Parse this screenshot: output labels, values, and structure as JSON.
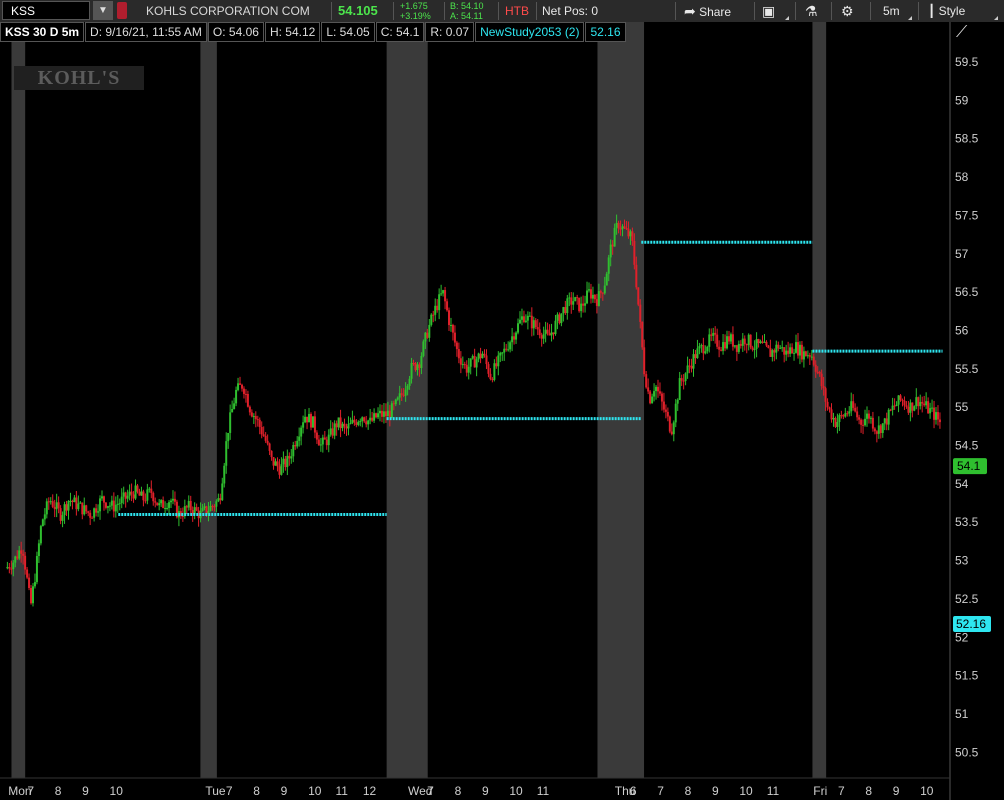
{
  "toolbar": {
    "symbol": "KSS",
    "company": "KOHLS CORPORATION COM",
    "last": "54.105",
    "change_abs": "+1.675",
    "change_pct": "+3.19%",
    "bid": "B: 54.10",
    "ask": "A: 54.11",
    "htb": "HTB",
    "net_pos": "Net Pos: 0",
    "share_label": "Share",
    "aggregation": "5m",
    "style_label": "Style"
  },
  "header": {
    "symbol_period": "KSS 30 D 5m",
    "date": "D: 9/16/21, 11:55 AM",
    "open": "O: 54.06",
    "high": "H: 54.12",
    "low": "L: 54.05",
    "close": "C: 54.1",
    "range": "R: 0.07",
    "study": "NewStudy2053 (2)",
    "study_value": "52.16"
  },
  "logo_text": "KOHĽS",
  "colors": {
    "up": "#2fbf2f",
    "down": "#e0202a",
    "study": "#2ee6f0",
    "shade": "#3a3a3a",
    "price_label": "#2fbf2f"
  },
  "chart_data": {
    "type": "candlestick",
    "y_axis": {
      "min": 50.25,
      "max": 59.75,
      "ticks": [
        "59.5",
        "59",
        "58.5",
        "58",
        "57.5",
        "57",
        "56.5",
        "56",
        "55.5",
        "55",
        "54.5",
        "54",
        "53.5",
        "53",
        "52.5",
        "52",
        "51.5",
        "51",
        "50.5"
      ]
    },
    "x_axis_labels": [
      {
        "label": "Mon",
        "t": 0.3
      },
      {
        "label": "7",
        "t": 1.0
      },
      {
        "label": "8",
        "t": 2.0
      },
      {
        "label": "9",
        "t": 3.0
      },
      {
        "label": "10",
        "t": 4.0
      },
      {
        "label": "Tue",
        "t": 7.5
      },
      {
        "label": "7",
        "t": 8.25
      },
      {
        "label": "8",
        "t": 9.25
      },
      {
        "label": "9",
        "t": 10.25
      },
      {
        "label": "10",
        "t": 11.25
      },
      {
        "label": "11",
        "t": 12.25
      },
      {
        "label": "12",
        "t": 13.25
      },
      {
        "label": "Wed",
        "t": 14.9
      },
      {
        "label": "7",
        "t": 15.6
      },
      {
        "label": "8",
        "t": 16.6
      },
      {
        "label": "9",
        "t": 17.6
      },
      {
        "label": "10",
        "t": 18.6
      },
      {
        "label": "11",
        "t": 19.6
      },
      {
        "label": "Thu",
        "t": 22.45
      },
      {
        "label": "6",
        "t": 23.0
      },
      {
        "label": "7",
        "t": 24.0
      },
      {
        "label": "8",
        "t": 25.0
      },
      {
        "label": "9",
        "t": 26.0
      },
      {
        "label": "10",
        "t": 27.0
      },
      {
        "label": "11",
        "t": 28.0
      },
      {
        "label": "Fri",
        "t": 29.7
      },
      {
        "label": "7",
        "t": 30.6
      },
      {
        "label": "8",
        "t": 31.6
      },
      {
        "label": "9",
        "t": 32.6
      },
      {
        "label": "10",
        "t": 33.6
      }
    ],
    "shaded_sessions": [
      [
        0.2,
        0.7
      ],
      [
        7.1,
        7.7
      ],
      [
        13.9,
        15.4
      ],
      [
        21.6,
        23.3
      ],
      [
        29.45,
        29.95
      ]
    ],
    "study_levels": [
      {
        "from": 4.1,
        "to": 13.9,
        "value": 53.6
      },
      {
        "from": 13.9,
        "to": 23.2,
        "value": 54.85
      },
      {
        "from": 23.2,
        "to": 29.45,
        "value": 57.15
      },
      {
        "from": 29.45,
        "to": 34.2,
        "value": 55.73
      }
    ],
    "price_path": [
      [
        0.0,
        52.9
      ],
      [
        0.3,
        53.0
      ],
      [
        0.6,
        53.2
      ],
      [
        0.9,
        52.4
      ],
      [
        1.1,
        52.9
      ],
      [
        1.3,
        53.5
      ],
      [
        1.6,
        53.8
      ],
      [
        2.0,
        53.6
      ],
      [
        2.3,
        53.8
      ],
      [
        2.7,
        53.7
      ],
      [
        3.1,
        53.6
      ],
      [
        3.5,
        53.8
      ],
      [
        3.9,
        53.7
      ],
      [
        4.3,
        53.8
      ],
      [
        4.7,
        53.9
      ],
      [
        5.0,
        53.8
      ],
      [
        5.3,
        53.9
      ],
      [
        5.6,
        53.7
      ],
      [
        6.0,
        53.8
      ],
      [
        6.3,
        53.6
      ],
      [
        6.7,
        53.7
      ],
      [
        7.1,
        53.6
      ],
      [
        7.5,
        53.7
      ],
      [
        7.8,
        53.8
      ],
      [
        8.1,
        54.7
      ],
      [
        8.4,
        55.2
      ],
      [
        8.65,
        55.3
      ],
      [
        8.9,
        55.0
      ],
      [
        9.2,
        54.8
      ],
      [
        9.45,
        54.6
      ],
      [
        9.7,
        54.3
      ],
      [
        10.0,
        54.2
      ],
      [
        10.3,
        54.3
      ],
      [
        10.6,
        54.6
      ],
      [
        10.9,
        54.9
      ],
      [
        11.2,
        54.8
      ],
      [
        11.5,
        54.5
      ],
      [
        11.8,
        54.6
      ],
      [
        12.1,
        54.8
      ],
      [
        12.4,
        54.7
      ],
      [
        12.7,
        54.8
      ],
      [
        13.0,
        54.9
      ],
      [
        13.3,
        54.8
      ],
      [
        13.6,
        54.9
      ],
      [
        13.9,
        54.9
      ],
      [
        14.2,
        55.0
      ],
      [
        14.5,
        55.2
      ],
      [
        14.8,
        55.5
      ],
      [
        15.1,
        55.6
      ],
      [
        15.4,
        56.0
      ],
      [
        15.7,
        56.3
      ],
      [
        15.95,
        56.5
      ],
      [
        16.2,
        56.1
      ],
      [
        16.5,
        55.7
      ],
      [
        16.8,
        55.5
      ],
      [
        17.1,
        55.6
      ],
      [
        17.4,
        55.7
      ],
      [
        17.7,
        55.4
      ],
      [
        18.0,
        55.6
      ],
      [
        18.3,
        55.8
      ],
      [
        18.6,
        56.0
      ],
      [
        18.9,
        56.2
      ],
      [
        19.2,
        56.1
      ],
      [
        19.5,
        56.0
      ],
      [
        19.8,
        55.9
      ],
      [
        20.1,
        56.1
      ],
      [
        20.4,
        56.3
      ],
      [
        20.7,
        56.4
      ],
      [
        21.0,
        56.3
      ],
      [
        21.3,
        56.5
      ],
      [
        21.6,
        56.4
      ],
      [
        21.85,
        56.6
      ],
      [
        22.1,
        57.1
      ],
      [
        22.35,
        57.4
      ],
      [
        22.6,
        57.3
      ],
      [
        22.85,
        57.2
      ],
      [
        23.0,
        56.7
      ],
      [
        23.15,
        56.1
      ],
      [
        23.3,
        55.5
      ],
      [
        23.5,
        55.1
      ],
      [
        23.7,
        55.3
      ],
      [
        24.0,
        55.0
      ],
      [
        24.3,
        54.7
      ],
      [
        24.6,
        55.3
      ],
      [
        24.9,
        55.5
      ],
      [
        25.2,
        55.7
      ],
      [
        25.5,
        55.8
      ],
      [
        25.8,
        55.9
      ],
      [
        26.1,
        55.8
      ],
      [
        26.4,
        55.9
      ],
      [
        26.7,
        55.8
      ],
      [
        27.0,
        55.9
      ],
      [
        27.3,
        55.8
      ],
      [
        27.6,
        55.8
      ],
      [
        27.9,
        55.7
      ],
      [
        28.2,
        55.8
      ],
      [
        28.5,
        55.7
      ],
      [
        28.8,
        55.8
      ],
      [
        29.1,
        55.7
      ],
      [
        29.4,
        55.7
      ],
      [
        29.7,
        55.4
      ],
      [
        30.0,
        55.0
      ],
      [
        30.3,
        54.8
      ],
      [
        30.6,
        54.9
      ],
      [
        30.9,
        55.0
      ],
      [
        31.2,
        54.8
      ],
      [
        31.5,
        54.9
      ],
      [
        31.8,
        54.7
      ],
      [
        32.1,
        54.8
      ],
      [
        32.4,
        55.0
      ],
      [
        32.7,
        55.1
      ],
      [
        33.0,
        55.0
      ],
      [
        33.3,
        55.1
      ],
      [
        33.6,
        55.0
      ],
      [
        33.9,
        54.9
      ],
      [
        34.1,
        54.8
      ]
    ],
    "price_label": "54.1",
    "study_label": "52.16"
  }
}
